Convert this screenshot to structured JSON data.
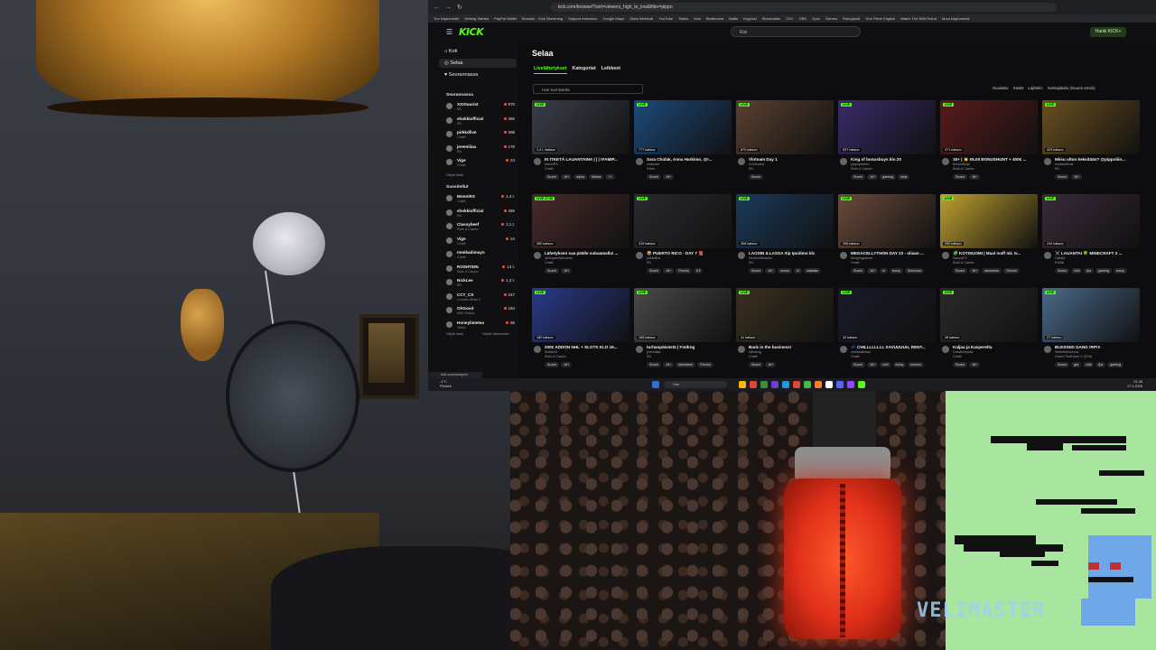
{
  "overlay": {
    "brand_text": "VELIMASTER"
  },
  "browser": {
    "address": "kick.com/browse/?sort=viewers_high_to_low&filter=pippo",
    "bookmarks": [
      "Tuo kirjanmerkit",
      "Getting Started",
      "PayPal Wallet",
      "Browser - Kick Streaming",
      "Support extension",
      "Google Maps",
      "Gitea Webmail",
      "YouTube",
      "Twitch",
      "Kick",
      "Beatmania",
      "Battle",
      "Kryptoki",
      "Streamlabs",
      "CDC",
      "OBS",
      "Sync",
      "Games",
      "Stronghold",
      "One Piece English",
      "Watch The Wild Robot",
      "Muut kirjanmerkit"
    ]
  },
  "kick": {
    "logo": "KICK",
    "search_placeholder": "Etsi",
    "user_button": "Hanki KICK+",
    "nav": {
      "home": "Koti",
      "browse": "Selaa",
      "following": "Seurannassa"
    },
    "following_header": "Seurannassa",
    "following": [
      {
        "name": "XXXtourist",
        "category": "IRL",
        "viewers": "870"
      },
      {
        "name": "shokkiofficial",
        "category": "IRL",
        "viewers": "465"
      },
      {
        "name": "pirkkdlive",
        "category": "Chatti",
        "viewers": "398"
      },
      {
        "name": "jeremiilaa",
        "category": "IRL",
        "viewers": "176"
      },
      {
        "name": "Vige",
        "category": "Chatti",
        "viewers": "24"
      }
    ],
    "following_more": "Näytä lisää",
    "recommended_header": "Suositellut",
    "recommended": [
      {
        "name": "MonniRS",
        "category": "Chatti",
        "viewers": "1,4 t."
      },
      {
        "name": "shokkiofficial",
        "category": "IRL",
        "viewers": "465"
      },
      {
        "name": "Classybeef",
        "category": "Slots & Casino",
        "viewers": "2,1 t."
      },
      {
        "name": "Vige",
        "category": "Chatti",
        "viewers": "24"
      },
      {
        "name": "mmikadimayn",
        "category": "Chatti",
        "viewers": ""
      },
      {
        "name": "ROSHTEIN",
        "category": "Slots & Casino",
        "viewers": "14 t."
      },
      {
        "name": "NickLee",
        "category": "IRL",
        "viewers": "1,3 t."
      },
      {
        "name": "CCT_CS",
        "category": "Counter-Strike 2",
        "viewers": "247"
      },
      {
        "name": "OhGood",
        "category": "ABC Roblox",
        "viewers": "184"
      },
      {
        "name": "Honeylimetea",
        "category": "Tabloi",
        "viewers": "55"
      }
    ],
    "recommended_more": "Näytä lisää",
    "recommended_less": "Näytä vähemmän",
    "page_title": "Selaa",
    "tabs": [
      "Livelähetykset",
      "Kategoriat",
      "Leikkeet"
    ],
    "filter_placeholder": "Hae tunnisteita",
    "sort": {
      "label_filter": "Suodata:",
      "filter_value": "Kielet",
      "sort_label": "Lajittele:",
      "sort_value": "Katsojaluku (Suurin ensin)"
    },
    "streams": [
      {
        "views": "1,4 t. katsoo",
        "title": "EI ITKETÄ LAUANTAINA | | | !FAMIP...",
        "streamer": "MonniRS",
        "category": "Chatti",
        "tags": [
          "Suomi",
          "18+",
          "alpha",
          "fitness",
          "+1"
        ]
      },
      {
        "views": "777 katsoo",
        "title": "Sara Chafak, Anna Harkimo, @r...",
        "streamer": "nelipoker",
        "category": "Poker",
        "tags": [
          "Suomi",
          "18+"
        ]
      },
      {
        "views": "870 katsoo",
        "title": "Vlotnam Day 1",
        "streamer": "XXXtourist",
        "category": "IRL",
        "tags": [
          "Suomi"
        ]
      },
      {
        "views": "537 katsoo",
        "title": "King of bonusbuys klo 20",
        "streamer": "pippoplexilex",
        "category": "Slots & Casino",
        "tags": [
          "Suomi",
          "18+",
          "gaming",
          "slots"
        ]
      },
      {
        "views": "471 katsoo",
        "title": "18+ | 💥 €6.00 BONUSHUNT + 400€ ...",
        "streamer": "BonkinBoys",
        "category": "Slots & Casino",
        "tags": [
          "Suomi",
          "18+"
        ]
      },
      {
        "views": "429 katsoo",
        "title": "Miisu ulton keksitään? @pippoliin...",
        "streamer": "shokkiofficial",
        "category": "IRL",
        "tags": [
          "Suomi",
          "18+"
        ]
      },
      {
        "views": "350 katsoo",
        "title": "Lähetyksen saa päälle subaamalla! ...",
        "streamer": "JkHuqaeMakkossa",
        "category": "Chatti",
        "tags": [
          "Suomi",
          "18+"
        ]
      },
      {
        "views": "315 katsoo",
        "title": "📦 PUERTO RICO - DAY 7 📕",
        "streamer": "pirkkdlive",
        "category": "IRL",
        "tags": [
          "Suomi",
          "18+",
          "Finnish",
          "fi fi"
        ]
      },
      {
        "views": "308 katsoo",
        "title": "LAOSIN ILLASSA !tip Ipodimo klc",
        "streamer": "HerrkuntMadina",
        "category": "IRL",
        "tags": [
          "Suomi",
          "18+",
          "suomi",
          "irl",
          "matkailu"
        ]
      },
      {
        "views": "296 katsoo",
        "title": "MEGACELLYTHON DAY 22 - oliaan ...",
        "streamer": "#Kaghkgraever",
        "category": "Chatti",
        "tags": [
          "Suomi",
          "18+",
          "irl",
          "funny",
          "Suburban"
        ]
      },
      {
        "views": "290 katsoo",
        "title": "🧩 KOTISUOMI | Maal !vaff !dc !v...",
        "streamer": "SampoF2",
        "category": "Slots & Casino",
        "tags": [
          "Suomi",
          "18+",
          "adventure",
          "Finnish"
        ]
      },
      {
        "views": "244 katsoo",
        "title": "⚔️ LAUANTAI 🍀 MINECRAFT 2 ...",
        "streamer": "Hyttala",
        "category": "PuBilit",
        "tags": [
          "Suomi",
          "chill",
          "fps",
          "gaming",
          "funny"
        ]
      },
      {
        "views": "180 katsoo",
        "title": "200€ ADDON NHL + SLOTS KLO 19...",
        "streamer": "Slotter62",
        "category": "Slots & Casino",
        "tags": [
          "Suomi",
          "18+"
        ]
      },
      {
        "views": "156 katsoo",
        "title": "turhanpäivästä | Fin/Eng",
        "streamer": "jeremiilaa",
        "category": "IRL",
        "tags": [
          "Suomi",
          "18+",
          "adventure",
          "Finnish"
        ]
      },
      {
        "views": "41 katsoo",
        "title": "Back in the business!",
        "streamer": "Hiilideng",
        "category": "Chatti",
        "tags": [
          "Suomi",
          "18+"
        ]
      },
      {
        "views": "32 katsoo",
        "title": "💤 CHILLLLLLLL SAVUUUUU, RENT...",
        "streamer": "mmikadimayn",
        "category": "Chatti",
        "tags": [
          "Suomi",
          "18+",
          "chill",
          "funny",
          "memes"
        ]
      },
      {
        "views": "28 katsoo",
        "title": "Kaljaa ja Kasperelta",
        "streamer": "Dunderlopoka",
        "category": "Chatti",
        "tags": [
          "Suomi",
          "18+"
        ]
      },
      {
        "views": "27 katsoo",
        "title": "BLESSED GANG !RP!!!",
        "streamer": "SeeketheVoroos",
        "category": "Grand Theft Auto V (GTA)",
        "tags": [
          "Suomi",
          "gta",
          "chill",
          "fps",
          "gaming"
        ]
      }
    ],
    "live_badge": "LIVE",
    "live_time_badge": "LIVE 17:38",
    "status_url": "kick.com/camp/nv"
  },
  "taskbar": {
    "weather_temp": "-1°C",
    "weather_text": "Pilvistä",
    "search_placeholder": "Hae",
    "time": "21.35",
    "date": "17.1.2025"
  },
  "colors": {
    "kick_green": "#53fc18",
    "lava_red": "#e0301a",
    "c64_green": "#a8e6a0"
  }
}
